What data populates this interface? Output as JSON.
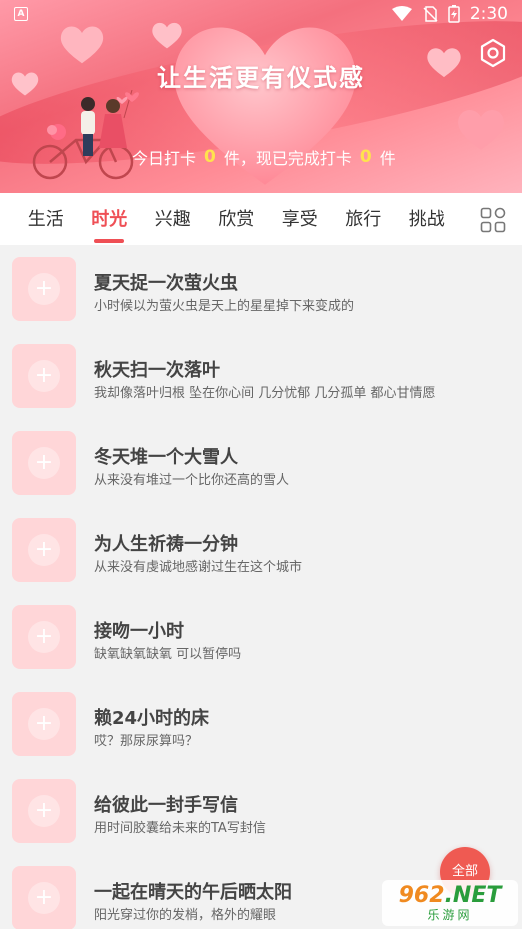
{
  "status_bar": {
    "app_badge": "A",
    "time": "2:30"
  },
  "header": {
    "title": "让生活更有仪式感",
    "checkin": {
      "prefix": "今日打卡",
      "today_count": "0",
      "middle": "件，现已完成打卡",
      "total_count": "0",
      "suffix": "件"
    }
  },
  "tabs": [
    {
      "label": "生活",
      "active": false
    },
    {
      "label": "时光",
      "active": true
    },
    {
      "label": "兴趣",
      "active": false
    },
    {
      "label": "欣赏",
      "active": false
    },
    {
      "label": "享受",
      "active": false
    },
    {
      "label": "旅行",
      "active": false
    },
    {
      "label": "挑战",
      "active": false
    }
  ],
  "items": [
    {
      "title": "夏天捉一次萤火虫",
      "subtitle": "小时候以为萤火虫是天上的星星掉下来变成的"
    },
    {
      "title": "秋天扫一次落叶",
      "subtitle": "我却像落叶归根 坠在你心间 几分忧郁 几分孤单 都心甘情愿"
    },
    {
      "title": "冬天堆一个大雪人",
      "subtitle": "从来没有堆过一个比你还高的雪人"
    },
    {
      "title": "为人生祈祷一分钟",
      "subtitle": "从来没有虔诚地感谢过生在这个城市"
    },
    {
      "title": "接吻一小时",
      "subtitle": "缺氧缺氧缺氧 可以暂停吗"
    },
    {
      "title": "赖24小时的床",
      "subtitle": "哎？那尿尿算吗？"
    },
    {
      "title": "给彼此一封手写信",
      "subtitle": "用时间胶囊给未来的TA写封信"
    },
    {
      "title": "一起在晴天的午后晒太阳",
      "subtitle": "阳光穿过你的发梢，格外的耀眼"
    }
  ],
  "fab": {
    "label": "全部"
  },
  "watermark": {
    "brand_a": "962",
    "brand_b": ".NET",
    "cn": "乐游网"
  },
  "colors": {
    "accent": "#ef4f55",
    "thumb_bg": "#ffd6d8",
    "checkin_number": "#ffe34d"
  }
}
